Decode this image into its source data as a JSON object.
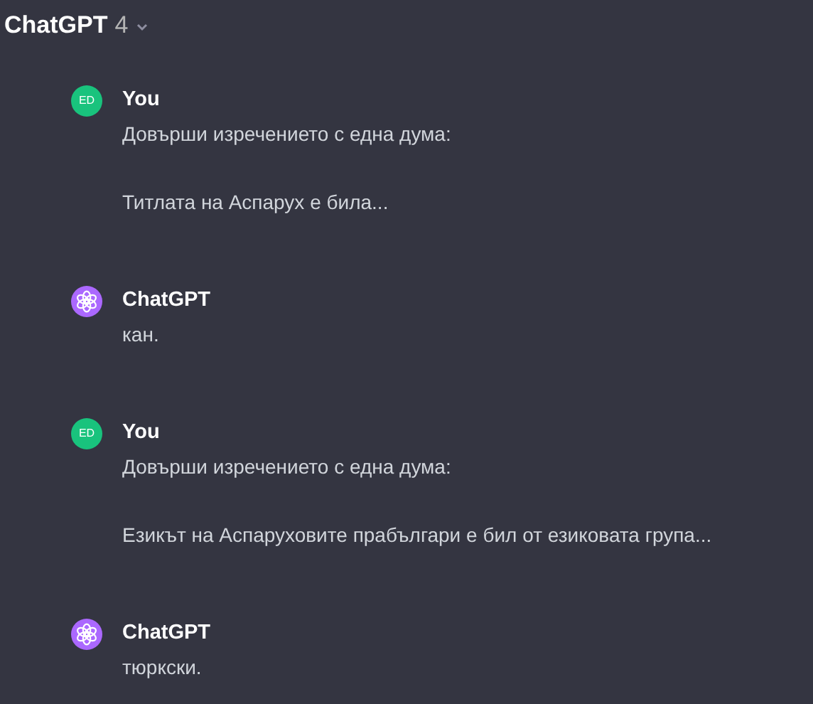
{
  "header": {
    "title": "ChatGPT",
    "version": "4"
  },
  "messages": [
    {
      "kind": "user",
      "author": "You",
      "avatar": "ED",
      "paragraphs": [
        "Довърши изречението с една дума:",
        "Титлата на Аспарух е била..."
      ]
    },
    {
      "kind": "assistant",
      "author": "ChatGPT",
      "paragraphs": [
        "кан."
      ]
    },
    {
      "kind": "user",
      "author": "You",
      "avatar": "ED",
      "paragraphs": [
        "Довърши изречението с една дума:",
        "Езикът на Аспаруховите прабългари е бил от езиковата група..."
      ]
    },
    {
      "kind": "assistant",
      "author": "ChatGPT",
      "paragraphs": [
        "тюркски."
      ]
    }
  ]
}
